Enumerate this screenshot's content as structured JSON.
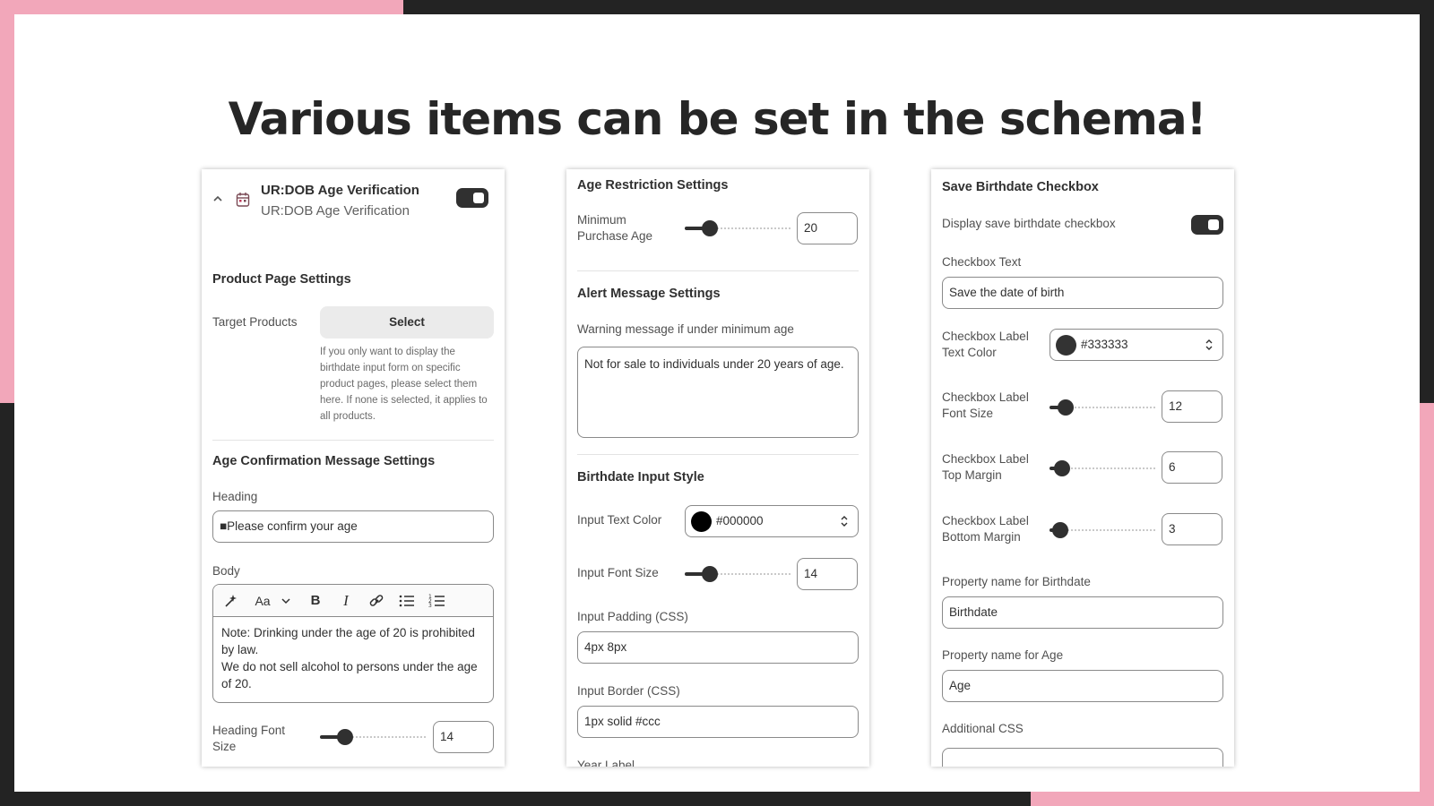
{
  "slide": {
    "title": "Various items can be set in the schema!",
    "colors": {
      "accent_pink": "#f2a7ba",
      "dark_frame": "#232323",
      "control": "#303030"
    }
  },
  "panel1": {
    "app_title": "UR:DOB Age Verification",
    "app_subtitle": "UR:DOB Age Verification",
    "app_enabled": true,
    "product_page": {
      "section_title": "Product Page Settings",
      "target_label": "Target Products",
      "select_label": "Select",
      "help_text": "If you only want to display the birthdate input form on specific product pages, please select them here. If none is selected, it applies to all products."
    },
    "age_confirmation": {
      "section_title": "Age Confirmation Message Settings",
      "heading_label": "Heading",
      "heading_value": "■Please confirm your age",
      "body_label": "Body",
      "toolbar": {
        "magic": "magic-icon",
        "font": "Aa",
        "bold": "B",
        "italic": "I",
        "link": "link-icon",
        "bullets": "bullet-list-icon",
        "numbered": "numbered-list-icon"
      },
      "body_line1": "Note: Drinking under the age of 20 is prohibited by law.",
      "body_line2": "We do not sell alcohol to persons under the age of 20.",
      "heading_font_size_label": "Heading Font Size",
      "heading_font_size_value": "14"
    }
  },
  "panel2": {
    "age_restriction": {
      "section_title": "Age Restriction Settings",
      "min_age_label": "Minimum Purchase Age",
      "min_age_value": "20"
    },
    "alert": {
      "section_title": "Alert Message Settings",
      "warning_label": "Warning message if under minimum age",
      "warning_value": "Not for sale to individuals under 20 years of age."
    },
    "input_style": {
      "section_title": "Birthdate Input Style",
      "text_color_label": "Input Text Color",
      "text_color_value": "#000000",
      "text_color_swatch": "#000000",
      "font_size_label": "Input Font Size",
      "font_size_value": "14",
      "padding_label": "Input Padding (CSS)",
      "padding_value": "4px 8px",
      "border_label": "Input Border (CSS)",
      "border_value": "1px solid #ccc",
      "year_label": "Year Label"
    }
  },
  "panel3": {
    "section_title": "Save Birthdate Checkbox",
    "display_label": "Display save birthdate checkbox",
    "display_enabled": true,
    "checkbox_text_label": "Checkbox Text",
    "checkbox_text_value": "Save the date of birth",
    "label_color_label": "Checkbox Label Text Color",
    "label_color_value": "#333333",
    "label_color_swatch": "#333333",
    "label_font_size_label": "Checkbox Label Font Size",
    "label_font_size_value": "12",
    "label_top_margin_label": "Checkbox Label Top Margin",
    "label_top_margin_value": "6",
    "label_bottom_margin_label": "Checkbox Label Bottom Margin",
    "label_bottom_margin_value": "3",
    "prop_birthdate_label": "Property name for Birthdate",
    "prop_birthdate_value": "Birthdate",
    "prop_age_label": "Property name for Age",
    "prop_age_value": "Age",
    "additional_css_label": "Additional CSS",
    "additional_css_value": ""
  }
}
